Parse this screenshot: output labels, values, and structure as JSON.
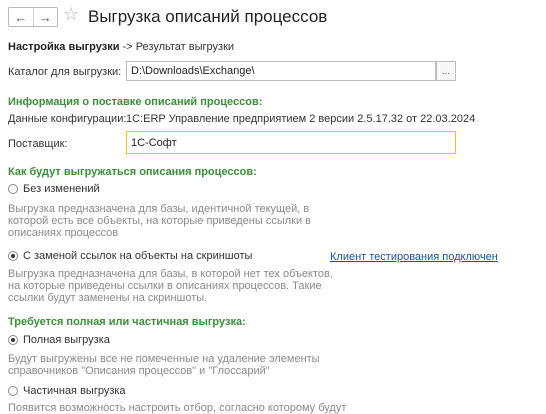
{
  "window": {
    "title": "Выгрузка описаний процессов"
  },
  "breadcrumbs": {
    "step_active": "Настройка выгрузки",
    "separator": "->",
    "step_next": "Результат выгрузки"
  },
  "catalog": {
    "label": "Каталог для выгрузки:",
    "value": "D:\\Downloads\\Exchange\\",
    "browse_label": "..."
  },
  "supply_info": {
    "heading": "Информация о поставке описаний процессов:",
    "config_label": "Данные конфигурации:",
    "config_value": "1С:ERP Управление предприятием 2 версии 2.5.17.32 от 22.03.2024",
    "supplier_label": "Поставщик:",
    "supplier_value": "1С-Софт"
  },
  "export_mode": {
    "heading": "Как будут выгружаться описания процессов:",
    "options": [
      {
        "label": "Без изменений",
        "checked": false,
        "description": [
          "Выгрузка предназначена для базы, идентичной текущей, в",
          "которой есть все объекты, на которые приведены ссылки в",
          "описаниях процессов"
        ]
      },
      {
        "label": "С заменой ссылок на объекты на скриншоты",
        "checked": true,
        "description": [
          "Выгрузка предназначена для базы, в которой нет тех объектов,",
          "на которые приведены ссылки в описаниях процессов. Такие",
          "ссылки будут заменены на скриншоты."
        ]
      }
    ],
    "test_client_link": "Клиент тестирования подключен"
  },
  "export_scope": {
    "heading": "Требуется полная или частичная выгрузка:",
    "options": [
      {
        "label": "Полная выгрузка",
        "checked": true,
        "description": [
          "Будут выгружены все не помеченные на удаление элементы",
          "справочников \"Описания процессов\" и \"Глоссарий\""
        ]
      },
      {
        "label": "Частичная выгрузка",
        "checked": false,
        "description": [
          "Появится возможность настроить отбор, согласно которому будут"
        ]
      }
    ]
  }
}
